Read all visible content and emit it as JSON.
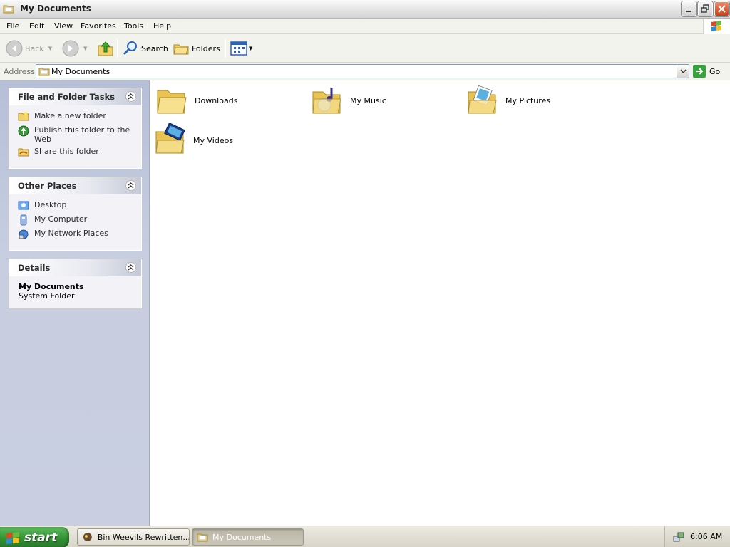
{
  "window": {
    "title": "My Documents"
  },
  "menu": [
    "File",
    "Edit",
    "View",
    "Favorites",
    "Tools",
    "Help"
  ],
  "toolbar": {
    "back_label": "Back",
    "search_label": "Search",
    "folders_label": "Folders"
  },
  "address": {
    "label": "Address",
    "value": "My Documents",
    "go_label": "Go"
  },
  "task_pane": {
    "file_folder_tasks": {
      "title": "File and Folder Tasks",
      "items": [
        "Make a new folder",
        "Publish this folder to the Web",
        "Share this folder"
      ]
    },
    "other_places": {
      "title": "Other Places",
      "items": [
        "Desktop",
        "My Computer",
        "My Network Places"
      ]
    },
    "details": {
      "title": "Details",
      "name": "My Documents",
      "type": "System Folder"
    }
  },
  "items": [
    {
      "label": "Downloads",
      "icon": "folder-icon"
    },
    {
      "label": "My Music",
      "icon": "music-folder-icon"
    },
    {
      "label": "My Pictures",
      "icon": "pictures-folder-icon"
    },
    {
      "label": "My Videos",
      "icon": "videos-folder-icon"
    }
  ],
  "taskbar": {
    "start_label": "start",
    "tasks": [
      "Bin Weevils Rewritten...",
      "My Documents"
    ],
    "clock": "6:06 AM"
  },
  "colors": {
    "task_pane_bg": "#c7cee0",
    "start_green": "#2f8f31",
    "close_red": "#c8401b",
    "address_border": "#7f9db9"
  }
}
